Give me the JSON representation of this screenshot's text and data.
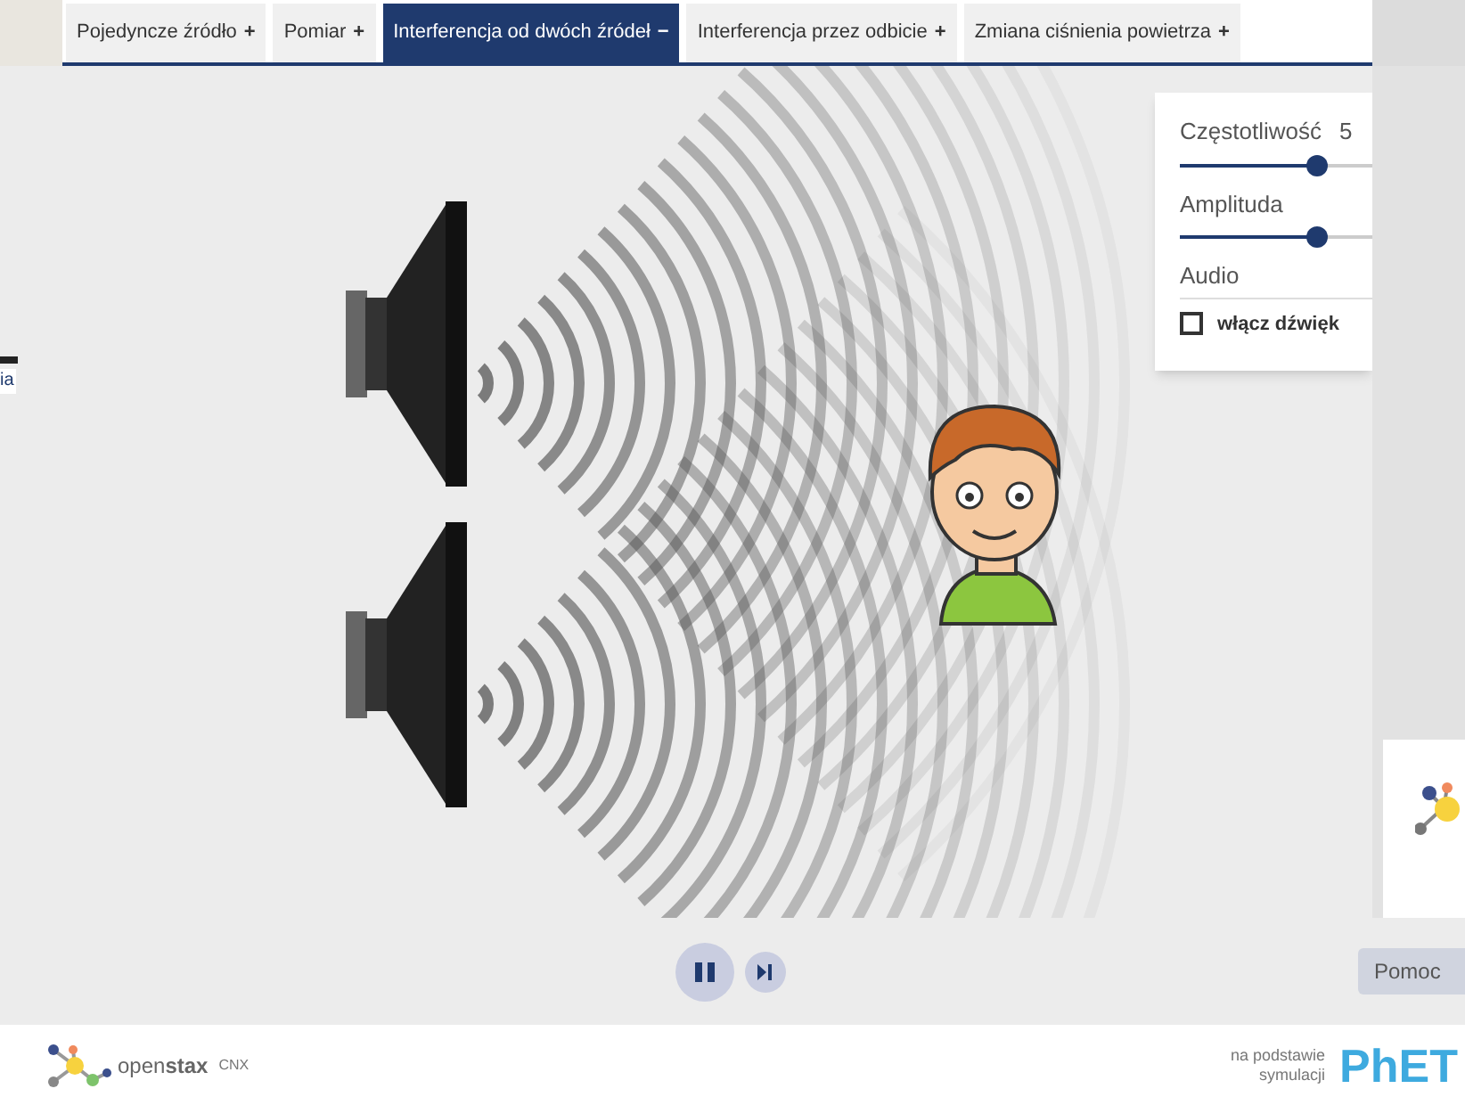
{
  "tabs": [
    {
      "label": "Pojedyncze źródło",
      "sign": "+",
      "selected": false
    },
    {
      "label": "Pomiar",
      "sign": "+",
      "selected": false
    },
    {
      "label": "Interferencja od dwóch źródeł",
      "sign": "−",
      "selected": true
    },
    {
      "label": "Interferencja przez odbicie",
      "sign": "+",
      "selected": false
    },
    {
      "label": "Zmiana ciśnienia powietrza",
      "sign": "+",
      "selected": false
    }
  ],
  "side_text": "ia",
  "panel": {
    "sliders": [
      {
        "label": "Częstotliwość",
        "value": "5",
        "level": 0.55
      },
      {
        "label": "Amplituda",
        "level": 0.55
      }
    ],
    "audio_heading": "Audio",
    "checkbox": {
      "label": "włącz dźwięk",
      "checked": false
    }
  },
  "playback": {
    "playing": true
  },
  "help_button": "Pomoc",
  "footer": {
    "openstax_plain": "open",
    "openstax_bold": "stax",
    "cnx": "CNX",
    "phet_caption": [
      "na podstawie",
      "symulacji"
    ],
    "phet": "PhET"
  }
}
